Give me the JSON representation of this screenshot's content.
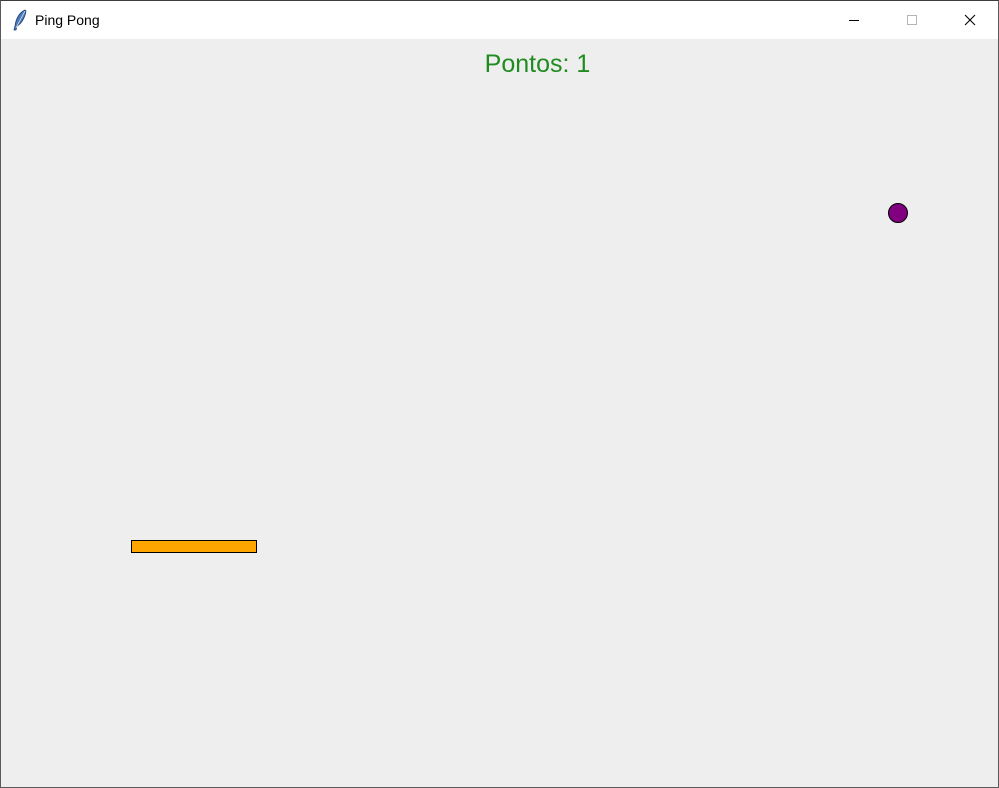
{
  "window": {
    "title": "Ping Pong",
    "app_icon": "feather-icon",
    "controls": {
      "minimize_icon": "minimize-icon",
      "maximize_icon": "maximize-icon",
      "close_icon": "close-icon"
    }
  },
  "game": {
    "score_label": "Pontos: 1",
    "colors": {
      "background": "#eeeeee",
      "score": "#1e8c1e",
      "ball": "#800080",
      "paddle": "#ffa500"
    }
  }
}
